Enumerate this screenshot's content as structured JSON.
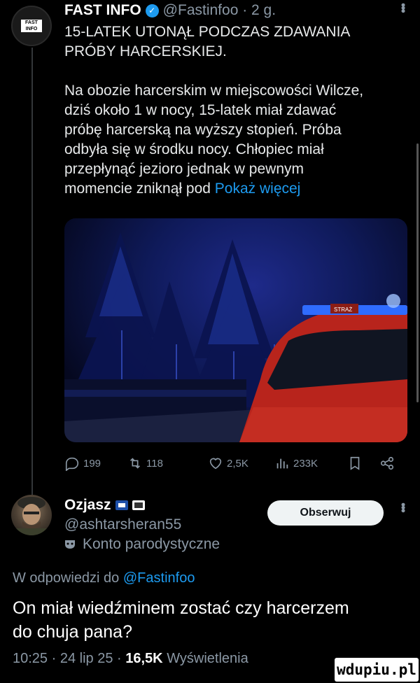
{
  "post": {
    "avatar_label": "FAST INFO",
    "author_name": "FAST INFO",
    "author_handle": "@Fastinfoo",
    "age": "2 g.",
    "headline_line1": "15-LATEK UTONĄŁ PODCZAS ZDAWANIA",
    "headline_line2": "PRÓBY HARCERSKIEJ.",
    "body_line1": "Na obozie harcerskim w miejscowości Wilcze,",
    "body_line2": "dziś około 1 w nocy, 15-latek miał zdawać",
    "body_line3": "próbę harcerską na wyższy stopień. Próba",
    "body_line4": "odbyła się w środku nocy. Chłopiec miał",
    "body_line5": "przepłynąć jezioro jednak w pewnym",
    "body_line6": "momencie zniknął pod",
    "show_more": "Pokaż więcej",
    "media_vehicle_marking": "STRAŻ",
    "actions": {
      "replies": "199",
      "reposts": "118",
      "likes": "2,5K",
      "views": "233K"
    }
  },
  "reply": {
    "author_name": "Ozjasz",
    "author_handle": "@ashtarsheran55",
    "account_type": "Konto parodystyczne",
    "follow_label": "Obserwuj",
    "replying_to_prefix": "W odpowiedzi do",
    "replying_to_handle": "@Fastinfoo",
    "text_line1": "On miał wiedźminem zostać czy harcerzem",
    "text_line2": "do chuja pana?",
    "time": "10:25",
    "date": "24 lip 25",
    "views_count": "16,5K",
    "views_label": "Wyświetlenia"
  },
  "watermark": "wdupiu.pl",
  "colors": {
    "background": "#000000",
    "text": "#e7e9ea",
    "muted": "#8b98a5",
    "link": "#1d9bf0"
  }
}
